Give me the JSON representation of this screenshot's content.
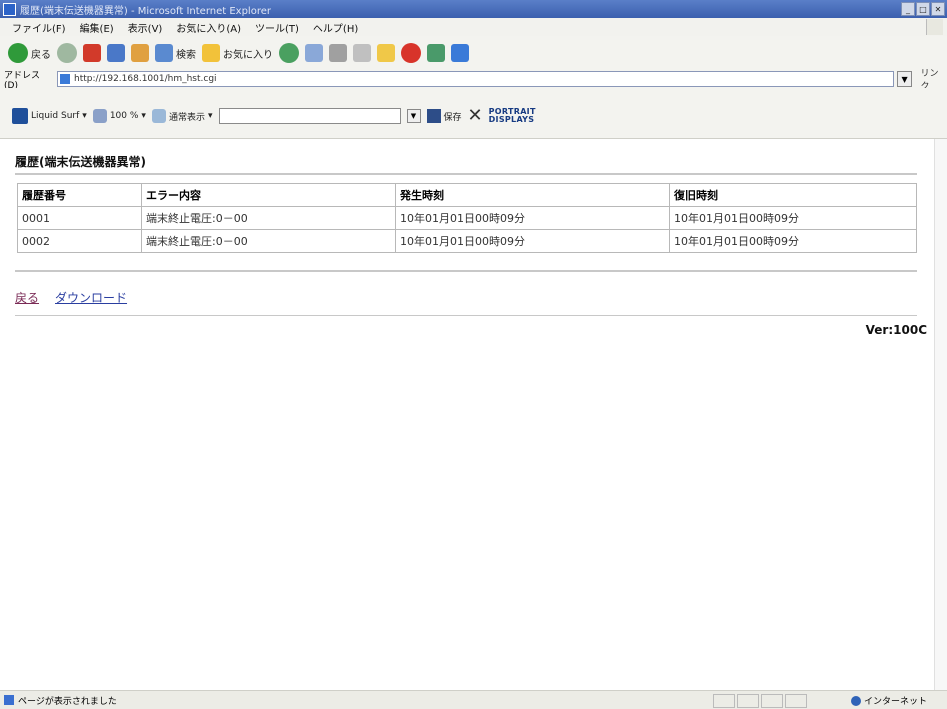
{
  "window": {
    "title": "履歴(端末伝送機器異常) - Microsoft Internet Explorer"
  },
  "menu": [
    "ファイル(F)",
    "編集(E)",
    "表示(V)",
    "お気に入り(A)",
    "ツール(T)",
    "ヘルプ(H)"
  ],
  "toolbar": {
    "back": "戻る",
    "search": "検索",
    "favorites": "お気に入り"
  },
  "address": {
    "label": "アドレス(D)",
    "url": "http://192.168.1001/hm_hst.cgi",
    "links": "リンク"
  },
  "extbar": {
    "liquid_surf": "Liquid Surf",
    "zoom": "100 %",
    "view": "通常表示",
    "save": "保存",
    "brand_line1": "PORTRAIT",
    "brand_line2": "DISPLAYS"
  },
  "page": {
    "title": "履歴(端末伝送機器異常)",
    "columns": [
      "履歴番号",
      "エラー内容",
      "発生時刻",
      "復旧時刻"
    ],
    "rows": [
      [
        "0001",
        "端末終止電圧:0－00",
        "10年01月01日00時09分",
        "10年01月01日00時09分"
      ],
      [
        "0002",
        "端末終止電圧:0－00",
        "10年01月01日00時09分",
        "10年01月01日00時09分"
      ]
    ],
    "back_link": "戻る",
    "download_link": "ダウンロード",
    "version": "Ver:100C"
  },
  "status": {
    "text": "ページが表示されました",
    "zone": "インターネット"
  }
}
